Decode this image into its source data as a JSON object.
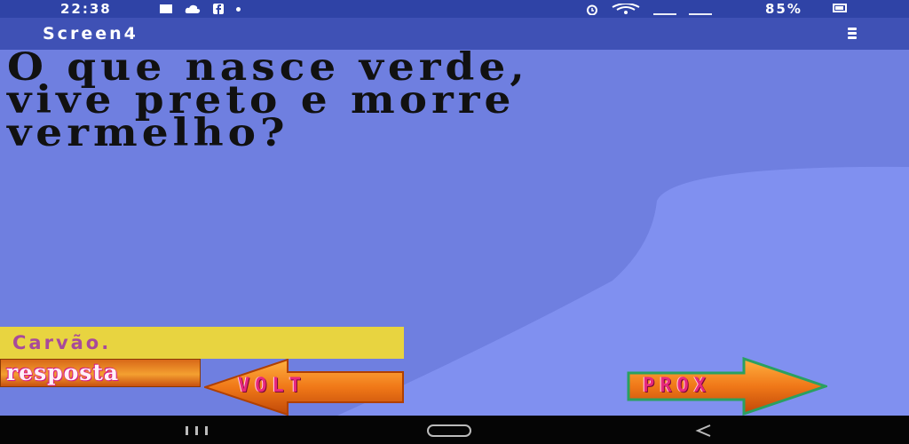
{
  "status_bar": {
    "time": "22:38",
    "battery": "85%",
    "left_icons": [
      "image-icon",
      "cloud-icon",
      "facebook-icon",
      "dot-icon"
    ],
    "right_icons": [
      "alarm-icon",
      "wifi-icon",
      "signal-icon",
      "volte-signal-icon",
      "battery-icon"
    ]
  },
  "app_bar": {
    "title": "Screen4",
    "menu_icon": "overflow-menu-icon"
  },
  "question": {
    "lines": [
      "O que nasce verde,",
      "vive preto e morre",
      "vermelho?"
    ]
  },
  "answer": {
    "text": "Carvão."
  },
  "buttons": {
    "resposta": "resposta",
    "volt": "VOLT",
    "prox": "PROX"
  },
  "colors": {
    "status_bar": "#2f43a6",
    "app_bar": "#3f51b5",
    "background": "#6f7fe0",
    "background_light": "#8090f0",
    "answer_box": "#e8d440",
    "answer_text": "#a84a9a",
    "arrow_orange": "#f08a20",
    "arrow_label": "#e8287c"
  },
  "nav_bar": {
    "icons": [
      "recents-icon",
      "home-icon",
      "back-icon"
    ]
  }
}
